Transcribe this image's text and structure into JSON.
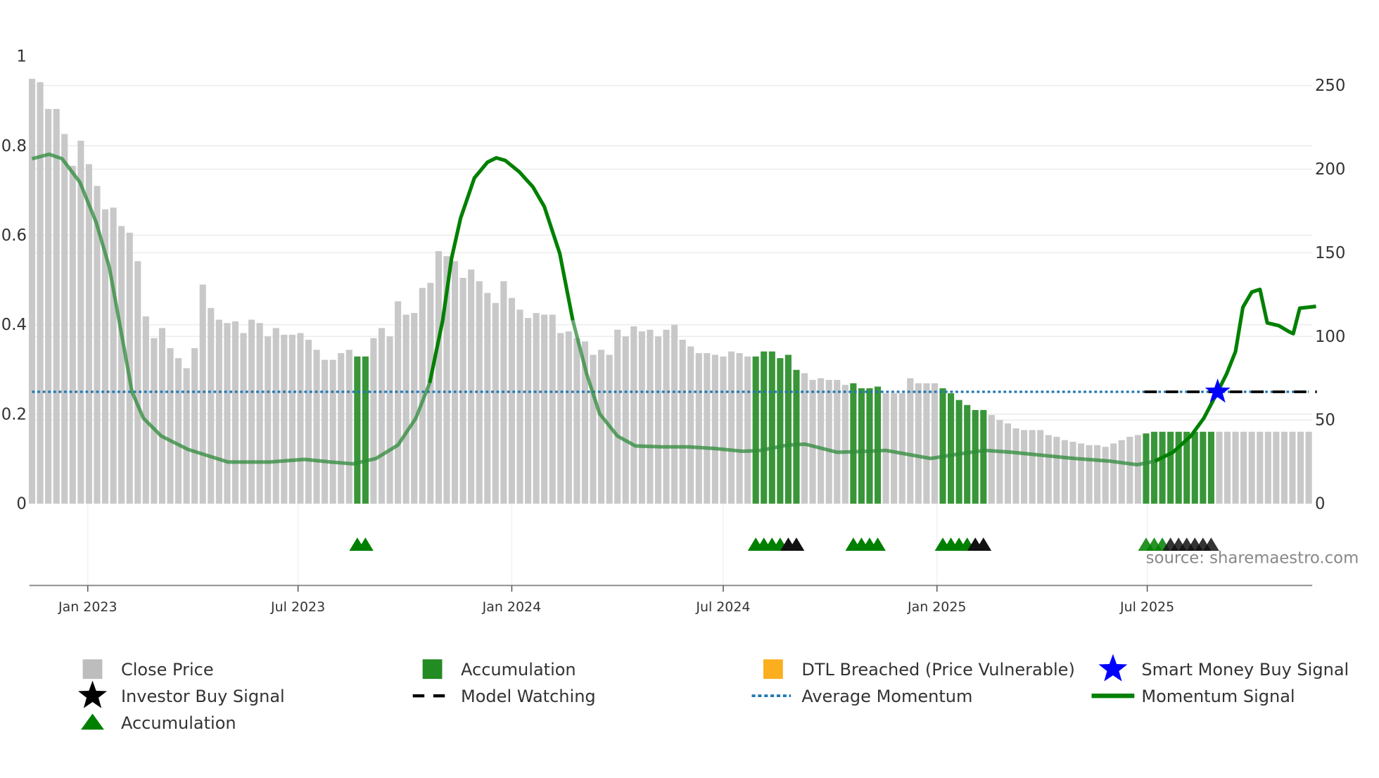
{
  "chart_data": {
    "type": "bar",
    "title": "",
    "source": "source: sharemaestro.com",
    "start_date": "2022-11-14",
    "interval_days": 7,
    "left_axis": {
      "label": "",
      "ylim": [
        0,
        1
      ],
      "ticks": [
        "0",
        "0.2",
        "0.4",
        "0.6",
        "0.8",
        "1"
      ],
      "tick_values": [
        0,
        0.2,
        0.4,
        0.6,
        0.8,
        1
      ]
    },
    "right_axis": {
      "label": "",
      "ylim": [
        0,
        267.5
      ],
      "ticks": [
        "0",
        "50",
        "100",
        "150",
        "200",
        "250"
      ],
      "tick_values": [
        0,
        50,
        100,
        150,
        200,
        250
      ]
    },
    "x_ticks": [
      {
        "label": "Jan 2023",
        "date": "2023-01-01"
      },
      {
        "label": "Jul 2023",
        "date": "2023-07-01"
      },
      {
        "label": "Jan 2024",
        "date": "2024-01-01"
      },
      {
        "label": "Jul 2024",
        "date": "2024-07-01"
      },
      {
        "label": "Jan 2025",
        "date": "2025-01-01"
      },
      {
        "label": "Jul 2025",
        "date": "2025-07-01"
      }
    ],
    "close_price": [
      254,
      252,
      236,
      236,
      221,
      202,
      217,
      203,
      190,
      176,
      177,
      166,
      162,
      145,
      112,
      99,
      105,
      93,
      87,
      81,
      93,
      131,
      117,
      110,
      108,
      109,
      102,
      110,
      108,
      100,
      105,
      101,
      101,
      102,
      98,
      92,
      86,
      86,
      90,
      92,
      88,
      88,
      99,
      105,
      100,
      121,
      113,
      114,
      129,
      132,
      151,
      148,
      145,
      135,
      140,
      133,
      126,
      120,
      133,
      123,
      116,
      111,
      114,
      113,
      113,
      102,
      103,
      99,
      97,
      89,
      92,
      89,
      104,
      100,
      106,
      103,
      104,
      100,
      104,
      107,
      98,
      94,
      90,
      90,
      89,
      88,
      91,
      90,
      88,
      88,
      91,
      91,
      87,
      89,
      80,
      78,
      74,
      75,
      74,
      74,
      71,
      72,
      69,
      69,
      70,
      66,
      66,
      66,
      75,
      72,
      72,
      72,
      69,
      66,
      62,
      59,
      56,
      56,
      53,
      50,
      48,
      45,
      44,
      44,
      44,
      41,
      40,
      38,
      37,
      36,
      35,
      35,
      34,
      36,
      38,
      40,
      41,
      42,
      43,
      43,
      43,
      43,
      43,
      43,
      43,
      43,
      43,
      43,
      43,
      43,
      43,
      43,
      43,
      43,
      43,
      43,
      43,
      43
    ],
    "accumulation_bars": [
      [
        40,
        41
      ],
      [
        89,
        94
      ],
      [
        101,
        104
      ],
      [
        112,
        117
      ],
      [
        137,
        145
      ]
    ],
    "triangle_markers": [
      {
        "index": 40,
        "type": "accumulation"
      },
      {
        "index": 41,
        "type": "accumulation"
      },
      {
        "index": 89,
        "type": "accumulation"
      },
      {
        "index": 90,
        "type": "accumulation"
      },
      {
        "index": 91,
        "type": "accumulation"
      },
      {
        "index": 92,
        "type": "accumulation"
      },
      {
        "index": 93,
        "type": "investor"
      },
      {
        "index": 94,
        "type": "investor"
      },
      {
        "index": 101,
        "type": "accumulation"
      },
      {
        "index": 102,
        "type": "accumulation"
      },
      {
        "index": 103,
        "type": "accumulation"
      },
      {
        "index": 104,
        "type": "accumulation"
      },
      {
        "index": 112,
        "type": "accumulation"
      },
      {
        "index": 113,
        "type": "accumulation"
      },
      {
        "index": 114,
        "type": "accumulation"
      },
      {
        "index": 115,
        "type": "accumulation"
      },
      {
        "index": 116,
        "type": "investor"
      },
      {
        "index": 117,
        "type": "investor"
      },
      {
        "index": 137,
        "type": "accumulation"
      },
      {
        "index": 138,
        "type": "accumulation"
      },
      {
        "index": 139,
        "type": "accumulation"
      },
      {
        "index": 140,
        "type": "investor"
      },
      {
        "index": 141,
        "type": "investor"
      },
      {
        "index": 142,
        "type": "investor"
      },
      {
        "index": 143,
        "type": "investor"
      },
      {
        "index": 144,
        "type": "investor"
      },
      {
        "index": 145,
        "type": "investor"
      }
    ],
    "momentum": [
      [
        0,
        0.771
      ],
      [
        2.1,
        0.781
      ],
      [
        3.7,
        0.771
      ],
      [
        5.9,
        0.718
      ],
      [
        7.9,
        0.628
      ],
      [
        9.5,
        0.529
      ],
      [
        10.9,
        0.39
      ],
      [
        12.3,
        0.25
      ],
      [
        13.7,
        0.191
      ],
      [
        15.9,
        0.151
      ],
      [
        19.2,
        0.121
      ],
      [
        24.1,
        0.093
      ],
      [
        29.1,
        0.093
      ],
      [
        33.5,
        0.099
      ],
      [
        36.8,
        0.093
      ],
      [
        39.5,
        0.089
      ],
      [
        42.3,
        0.101
      ],
      [
        45,
        0.131
      ],
      [
        47.2,
        0.191
      ],
      [
        48.9,
        0.27
      ],
      [
        50.5,
        0.41
      ],
      [
        51.6,
        0.549
      ],
      [
        52.7,
        0.638
      ],
      [
        54.4,
        0.728
      ],
      [
        56,
        0.763
      ],
      [
        57.1,
        0.773
      ],
      [
        58.2,
        0.767
      ],
      [
        59.9,
        0.742
      ],
      [
        61.6,
        0.708
      ],
      [
        63,
        0.664
      ],
      [
        64.9,
        0.559
      ],
      [
        66.5,
        0.41
      ],
      [
        68.2,
        0.29
      ],
      [
        69.8,
        0.201
      ],
      [
        72,
        0.151
      ],
      [
        74.2,
        0.129
      ],
      [
        77.5,
        0.127
      ],
      [
        80.8,
        0.127
      ],
      [
        84.1,
        0.123
      ],
      [
        87.4,
        0.117
      ],
      [
        89.6,
        0.119
      ],
      [
        92.9,
        0.131
      ],
      [
        95.1,
        0.133
      ],
      [
        99,
        0.115
      ],
      [
        102.8,
        0.117
      ],
      [
        105,
        0.119
      ],
      [
        110.5,
        0.101
      ],
      [
        113.9,
        0.111
      ],
      [
        117.2,
        0.119
      ],
      [
        120.5,
        0.115
      ],
      [
        124.9,
        0.107
      ],
      [
        128.2,
        0.101
      ],
      [
        132.6,
        0.095
      ],
      [
        135.9,
        0.087
      ],
      [
        138.1,
        0.095
      ],
      [
        140.3,
        0.115
      ],
      [
        142.5,
        0.151
      ],
      [
        144.1,
        0.191
      ],
      [
        145.8,
        0.25
      ],
      [
        146.9,
        0.29
      ],
      [
        148,
        0.34
      ],
      [
        148.9,
        0.439
      ],
      [
        150,
        0.473
      ],
      [
        151,
        0.479
      ],
      [
        151.9,
        0.404
      ],
      [
        153.3,
        0.398
      ],
      [
        154.6,
        0.384
      ],
      [
        155.1,
        0.38
      ],
      [
        155.9,
        0.437
      ],
      [
        157.9,
        0.441
      ]
    ],
    "momentum_strong_ranges": [
      [
        48,
        68
      ],
      [
        137,
        158
      ]
    ],
    "average_momentum": 0.25,
    "model_watching": {
      "from_index": 136.8,
      "to_index": 158,
      "value": 0.25
    },
    "smart_money_buy_signal": {
      "index": 145.8,
      "value": 0.25
    },
    "colors": {
      "price": "#c8c8c8",
      "accumulation": "#228B22",
      "momentum": "#008000",
      "avg": "#1f77b4",
      "dtl": "#FBAF1F",
      "smart": "#0000ff",
      "investor": "#000000"
    },
    "legend": [
      {
        "label": "Close Price",
        "icon": "gray-square"
      },
      {
        "label": "Accumulation",
        "icon": "green-square"
      },
      {
        "label": "DTL Breached (Price Vulnerable)",
        "icon": "orange-square"
      },
      {
        "label": "Smart Money Buy Signal",
        "icon": "blue-star"
      },
      {
        "label": "Investor Buy Signal",
        "icon": "black-star"
      },
      {
        "label": "Model Watching",
        "icon": "black-dash"
      },
      {
        "label": "Average Momentum",
        "icon": "blue-dots"
      },
      {
        "label": "Momentum Signal",
        "icon": "green-line"
      },
      {
        "label": "Accumulation",
        "icon": "green-triangle"
      }
    ]
  }
}
